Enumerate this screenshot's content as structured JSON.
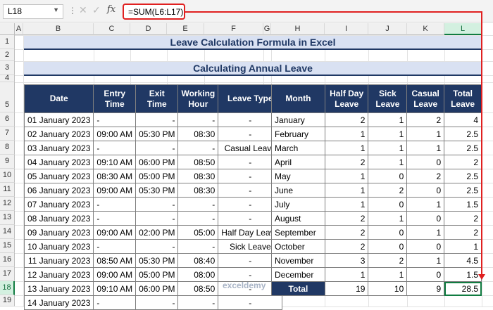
{
  "name_box": "L18",
  "formula": "=SUM(L6:L17)",
  "fx_label": "fx",
  "columns": [
    "A",
    "B",
    "C",
    "D",
    "E",
    "F",
    "G",
    "H",
    "I",
    "J",
    "K",
    "L"
  ],
  "rows": [
    "1",
    "2",
    "3",
    "4",
    "5",
    "6",
    "7",
    "8",
    "9",
    "10",
    "11",
    "12",
    "13",
    "14",
    "15",
    "16",
    "17",
    "18",
    "19"
  ],
  "main_title": "Leave Calculation Formula in Excel",
  "sub_title": "Calculating Annual Leave",
  "left_table": {
    "headers": [
      "Date",
      "Entry Time",
      "Exit Time",
      "Working Hour",
      "Leave Type"
    ],
    "rows": [
      [
        "01 January 2023",
        "-",
        "-",
        "-",
        "-"
      ],
      [
        "02 January 2023",
        "09:00 AM",
        "05:30 PM",
        "08:30",
        "-"
      ],
      [
        "03 January 2023",
        "-",
        "-",
        "-",
        "Casual Leave"
      ],
      [
        "04 January 2023",
        "09:10 AM",
        "06:00 PM",
        "08:50",
        "-"
      ],
      [
        "05 January 2023",
        "08:30 AM",
        "05:00 PM",
        "08:30",
        "-"
      ],
      [
        "06 January 2023",
        "09:00 AM",
        "05:30 PM",
        "08:30",
        "-"
      ],
      [
        "07 January 2023",
        "-",
        "-",
        "-",
        "-"
      ],
      [
        "08 January 2023",
        "-",
        "-",
        "-",
        "-"
      ],
      [
        "09 January 2023",
        "09:00 AM",
        "02:00 PM",
        "05:00",
        "Half Day Leave"
      ],
      [
        "10 January 2023",
        "-",
        "-",
        "-",
        "Sick Leave"
      ],
      [
        "11 January 2023",
        "08:50 AM",
        "05:30 PM",
        "08:40",
        "-"
      ],
      [
        "12 January 2023",
        "09:00 AM",
        "05:00 PM",
        "08:00",
        "-"
      ],
      [
        "13 January 2023",
        "09:10 AM",
        "06:00 PM",
        "08:50",
        "-"
      ],
      [
        "14 January 2023",
        "-",
        "-",
        "-",
        "-"
      ]
    ]
  },
  "right_table": {
    "headers": [
      "Month",
      "Half Day Leave",
      "Sick Leave",
      "Casual Leave",
      "Total Leave"
    ],
    "rows": [
      [
        "January",
        "2",
        "1",
        "2",
        "4"
      ],
      [
        "February",
        "1",
        "1",
        "1",
        "2.5"
      ],
      [
        "March",
        "1",
        "1",
        "1",
        "2.5"
      ],
      [
        "April",
        "2",
        "1",
        "0",
        "2"
      ],
      [
        "May",
        "1",
        "0",
        "2",
        "2.5"
      ],
      [
        "June",
        "1",
        "2",
        "0",
        "2.5"
      ],
      [
        "July",
        "1",
        "0",
        "1",
        "1.5"
      ],
      [
        "August",
        "2",
        "1",
        "0",
        "2"
      ],
      [
        "September",
        "2",
        "0",
        "1",
        "2"
      ],
      [
        "October",
        "2",
        "0",
        "0",
        "1"
      ],
      [
        "November",
        "3",
        "2",
        "1",
        "4.5"
      ],
      [
        "December",
        "1",
        "1",
        "0",
        "1.5"
      ]
    ],
    "total": [
      "Total",
      "19",
      "10",
      "9",
      "28.5"
    ]
  },
  "watermark": "exceldemy"
}
